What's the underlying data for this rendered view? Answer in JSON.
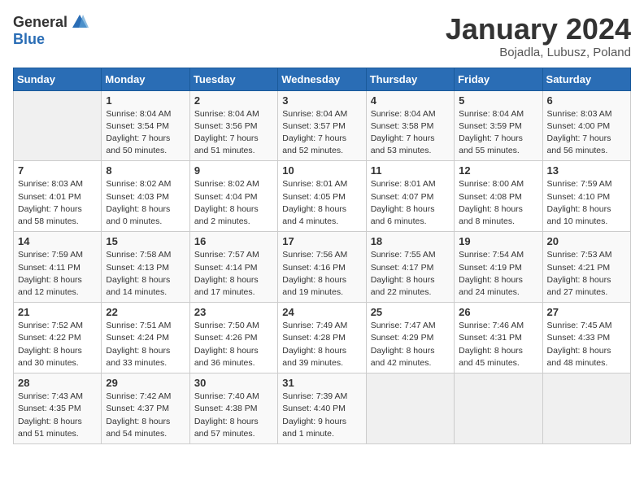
{
  "header": {
    "logo_general": "General",
    "logo_blue": "Blue",
    "month_title": "January 2024",
    "location": "Bojadla, Lubusz, Poland"
  },
  "days_of_week": [
    "Sunday",
    "Monday",
    "Tuesday",
    "Wednesday",
    "Thursday",
    "Friday",
    "Saturday"
  ],
  "weeks": [
    [
      {
        "day": "",
        "info": ""
      },
      {
        "day": "1",
        "info": "Sunrise: 8:04 AM\nSunset: 3:54 PM\nDaylight: 7 hours\nand 50 minutes."
      },
      {
        "day": "2",
        "info": "Sunrise: 8:04 AM\nSunset: 3:56 PM\nDaylight: 7 hours\nand 51 minutes."
      },
      {
        "day": "3",
        "info": "Sunrise: 8:04 AM\nSunset: 3:57 PM\nDaylight: 7 hours\nand 52 minutes."
      },
      {
        "day": "4",
        "info": "Sunrise: 8:04 AM\nSunset: 3:58 PM\nDaylight: 7 hours\nand 53 minutes."
      },
      {
        "day": "5",
        "info": "Sunrise: 8:04 AM\nSunset: 3:59 PM\nDaylight: 7 hours\nand 55 minutes."
      },
      {
        "day": "6",
        "info": "Sunrise: 8:03 AM\nSunset: 4:00 PM\nDaylight: 7 hours\nand 56 minutes."
      }
    ],
    [
      {
        "day": "7",
        "info": "Sunrise: 8:03 AM\nSunset: 4:01 PM\nDaylight: 7 hours\nand 58 minutes."
      },
      {
        "day": "8",
        "info": "Sunrise: 8:02 AM\nSunset: 4:03 PM\nDaylight: 8 hours\nand 0 minutes."
      },
      {
        "day": "9",
        "info": "Sunrise: 8:02 AM\nSunset: 4:04 PM\nDaylight: 8 hours\nand 2 minutes."
      },
      {
        "day": "10",
        "info": "Sunrise: 8:01 AM\nSunset: 4:05 PM\nDaylight: 8 hours\nand 4 minutes."
      },
      {
        "day": "11",
        "info": "Sunrise: 8:01 AM\nSunset: 4:07 PM\nDaylight: 8 hours\nand 6 minutes."
      },
      {
        "day": "12",
        "info": "Sunrise: 8:00 AM\nSunset: 4:08 PM\nDaylight: 8 hours\nand 8 minutes."
      },
      {
        "day": "13",
        "info": "Sunrise: 7:59 AM\nSunset: 4:10 PM\nDaylight: 8 hours\nand 10 minutes."
      }
    ],
    [
      {
        "day": "14",
        "info": "Sunrise: 7:59 AM\nSunset: 4:11 PM\nDaylight: 8 hours\nand 12 minutes."
      },
      {
        "day": "15",
        "info": "Sunrise: 7:58 AM\nSunset: 4:13 PM\nDaylight: 8 hours\nand 14 minutes."
      },
      {
        "day": "16",
        "info": "Sunrise: 7:57 AM\nSunset: 4:14 PM\nDaylight: 8 hours\nand 17 minutes."
      },
      {
        "day": "17",
        "info": "Sunrise: 7:56 AM\nSunset: 4:16 PM\nDaylight: 8 hours\nand 19 minutes."
      },
      {
        "day": "18",
        "info": "Sunrise: 7:55 AM\nSunset: 4:17 PM\nDaylight: 8 hours\nand 22 minutes."
      },
      {
        "day": "19",
        "info": "Sunrise: 7:54 AM\nSunset: 4:19 PM\nDaylight: 8 hours\nand 24 minutes."
      },
      {
        "day": "20",
        "info": "Sunrise: 7:53 AM\nSunset: 4:21 PM\nDaylight: 8 hours\nand 27 minutes."
      }
    ],
    [
      {
        "day": "21",
        "info": "Sunrise: 7:52 AM\nSunset: 4:22 PM\nDaylight: 8 hours\nand 30 minutes."
      },
      {
        "day": "22",
        "info": "Sunrise: 7:51 AM\nSunset: 4:24 PM\nDaylight: 8 hours\nand 33 minutes."
      },
      {
        "day": "23",
        "info": "Sunrise: 7:50 AM\nSunset: 4:26 PM\nDaylight: 8 hours\nand 36 minutes."
      },
      {
        "day": "24",
        "info": "Sunrise: 7:49 AM\nSunset: 4:28 PM\nDaylight: 8 hours\nand 39 minutes."
      },
      {
        "day": "25",
        "info": "Sunrise: 7:47 AM\nSunset: 4:29 PM\nDaylight: 8 hours\nand 42 minutes."
      },
      {
        "day": "26",
        "info": "Sunrise: 7:46 AM\nSunset: 4:31 PM\nDaylight: 8 hours\nand 45 minutes."
      },
      {
        "day": "27",
        "info": "Sunrise: 7:45 AM\nSunset: 4:33 PM\nDaylight: 8 hours\nand 48 minutes."
      }
    ],
    [
      {
        "day": "28",
        "info": "Sunrise: 7:43 AM\nSunset: 4:35 PM\nDaylight: 8 hours\nand 51 minutes."
      },
      {
        "day": "29",
        "info": "Sunrise: 7:42 AM\nSunset: 4:37 PM\nDaylight: 8 hours\nand 54 minutes."
      },
      {
        "day": "30",
        "info": "Sunrise: 7:40 AM\nSunset: 4:38 PM\nDaylight: 8 hours\nand 57 minutes."
      },
      {
        "day": "31",
        "info": "Sunrise: 7:39 AM\nSunset: 4:40 PM\nDaylight: 9 hours\nand 1 minute."
      },
      {
        "day": "",
        "info": ""
      },
      {
        "day": "",
        "info": ""
      },
      {
        "day": "",
        "info": ""
      }
    ]
  ]
}
